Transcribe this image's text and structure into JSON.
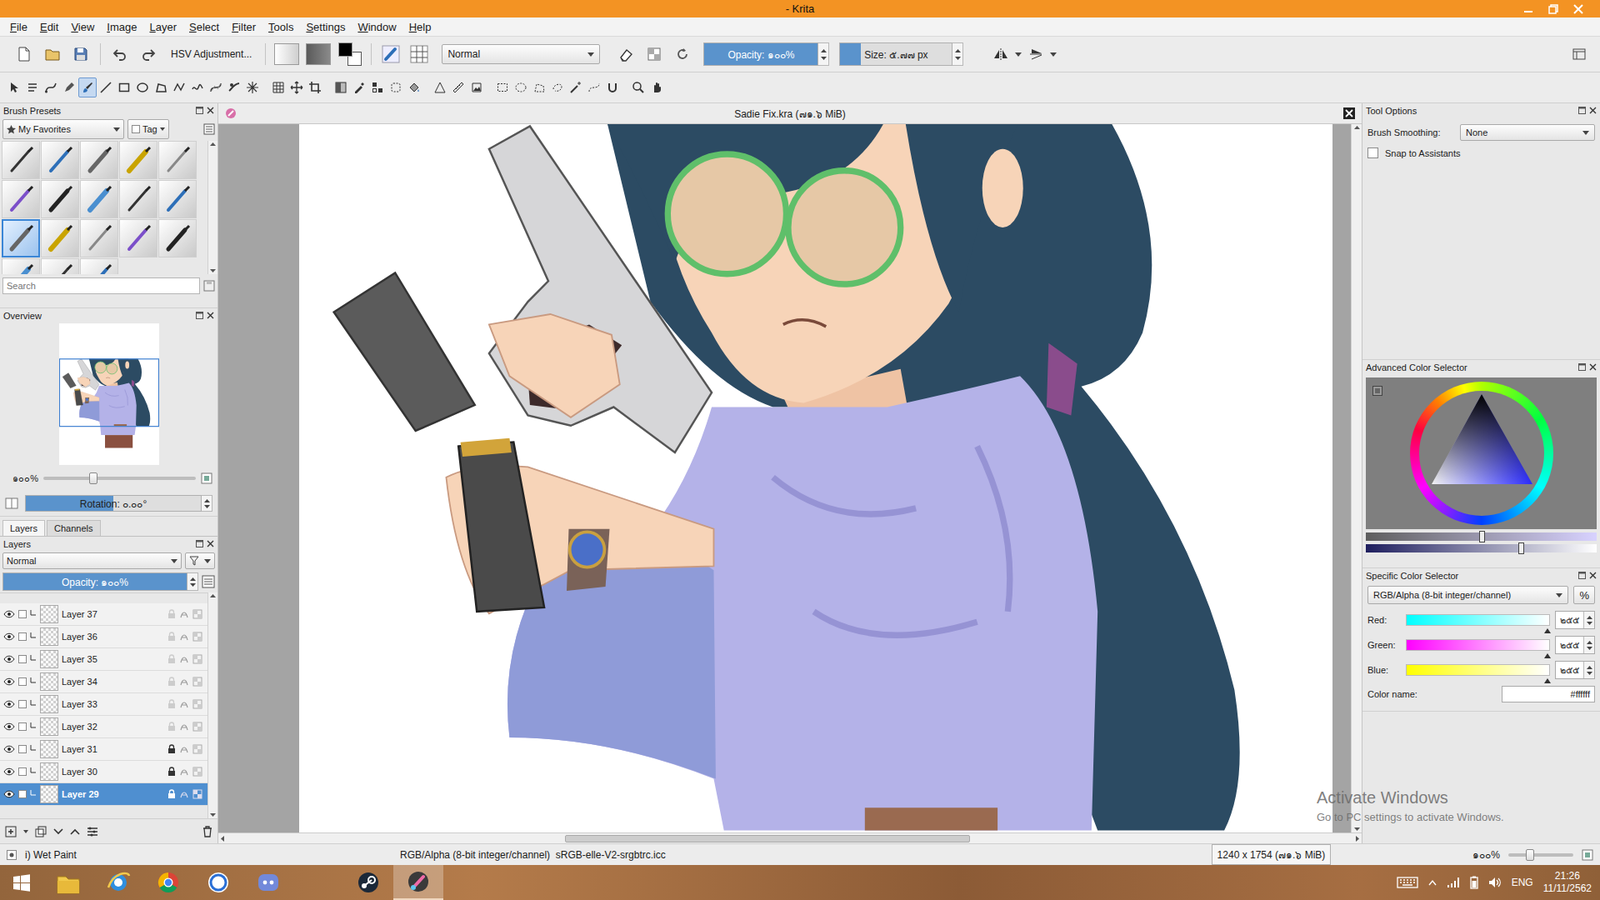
{
  "window": {
    "title": "- Krita"
  },
  "menu": [
    {
      "label": "File"
    },
    {
      "label": "Edit"
    },
    {
      "label": "View"
    },
    {
      "label": "Image"
    },
    {
      "label": "Layer"
    },
    {
      "label": "Select"
    },
    {
      "label": "Filter"
    },
    {
      "label": "Tools"
    },
    {
      "label": "Settings"
    },
    {
      "label": "Window"
    },
    {
      "label": "Help"
    }
  ],
  "toolbar": {
    "filter": "HSV Adjustment...",
    "foreground": "#000000",
    "background": "#ffffff",
    "blend_mode": "Normal",
    "opacity": {
      "reading": "Opacity: ๑๐๐%",
      "level": 1
    },
    "size": {
      "reading": "Size: ๕.๗๗ px",
      "level": 0.18
    }
  },
  "tools": {
    "groups": [
      [
        {
          "selected": false
        },
        {
          "selected": false
        },
        {
          "selected": false
        },
        {
          "selected": false
        },
        {
          "selected": true
        },
        {
          "selected": false
        },
        {
          "selected": false
        },
        {
          "selected": false
        },
        {
          "selected": false
        },
        {
          "selected": false
        },
        {
          "selected": false
        },
        {
          "selected": false
        },
        {
          "selected": false
        },
        {
          "selected": false
        }
      ],
      [
        {
          "selected": false
        },
        {
          "selected": false
        },
        {
          "selected": false
        }
      ],
      [
        {
          "selected": false
        },
        {
          "selected": false
        },
        {
          "selected": false
        },
        {
          "selected": false
        },
        {
          "selected": false
        }
      ],
      [
        {
          "selected": false
        },
        {
          "selected": false
        },
        {
          "selected": false
        }
      ],
      [
        {
          "selected": false
        },
        {
          "selected": false
        },
        {
          "selected": false
        },
        {
          "selected": false
        },
        {
          "selected": false
        },
        {
          "selected": false
        },
        {
          "selected": false
        }
      ],
      [
        {
          "selected": false
        },
        {
          "selected": false
        }
      ]
    ]
  },
  "brush_presets": {
    "title": "Brush Presets",
    "tag": "My Favorites",
    "tag_button": "Tag",
    "search_placeholder": "Search",
    "presets": [
      {
        "selected": false
      },
      {
        "selected": false
      },
      {
        "selected": false
      },
      {
        "selected": false
      },
      {
        "selected": false
      },
      {
        "selected": false
      },
      {
        "selected": false
      },
      {
        "selected": false
      },
      {
        "selected": false
      },
      {
        "selected": false
      },
      {
        "selected": true
      },
      {
        "selected": false
      },
      {
        "selected": false
      },
      {
        "selected": false
      },
      {
        "selected": false
      },
      {
        "selected": false
      },
      {
        "selected": false
      },
      {
        "selected": false
      }
    ]
  },
  "overview": {
    "title": "Overview",
    "zoom": "๑๐๐%",
    "zoom_level": 0.33,
    "rotation": "Rotation: ๐.๐๐°",
    "rotation_level": 0.5
  },
  "layers": {
    "tabs": [
      {
        "label": "Layers",
        "selected": true
      },
      {
        "label": "Channels",
        "selected": false
      }
    ],
    "title": "Layers",
    "blend_mode": "Normal",
    "opacity": {
      "reading": "Opacity: ๑๐๐%",
      "level": 1
    },
    "items": [
      {
        "name": "Layer 37",
        "visible": true,
        "locked": false,
        "selected": false
      },
      {
        "name": "Layer 36",
        "visible": true,
        "locked": false,
        "selected": false
      },
      {
        "name": "Layer 35",
        "visible": true,
        "locked": false,
        "selected": false
      },
      {
        "name": "Layer 34",
        "visible": true,
        "locked": false,
        "selected": false
      },
      {
        "name": "Layer 33",
        "visible": true,
        "locked": false,
        "selected": false
      },
      {
        "name": "Layer 32",
        "visible": true,
        "locked": false,
        "selected": false
      },
      {
        "name": "Layer 31",
        "visible": true,
        "locked": true,
        "selected": false
      },
      {
        "name": "Layer 30",
        "visible": true,
        "locked": true,
        "selected": false
      },
      {
        "name": "Layer 29",
        "visible": true,
        "locked": true,
        "selected": true
      }
    ]
  },
  "document": {
    "title": "Sadie Fix.kra (๗๑.๖ MiB)"
  },
  "tool_options": {
    "title": "Tool Options",
    "smoothing_label": "Brush Smoothing:",
    "smoothing_value": "None",
    "snap_label": "Snap to Assistants",
    "snap_checked": false
  },
  "advanced_color": {
    "title": "Advanced Color Selector",
    "sliders": [
      {
        "level": 0.5
      },
      {
        "level": 0.67
      }
    ]
  },
  "specific_color": {
    "title": "Specific Color Selector",
    "model": "RGB/Alpha (8-bit integer/channel)",
    "percent": "%",
    "channels": [
      {
        "label": "Red:",
        "value": "๒๕๕",
        "level": 1,
        "color": "#00ffff"
      },
      {
        "label": "Green:",
        "value": "๒๕๕",
        "level": 1,
        "color": "#ff00ff"
      },
      {
        "label": "Blue:",
        "value": "๒๕๕",
        "level": 1,
        "color": "#ffff00"
      }
    ],
    "color_name_label": "Color name:",
    "color_name": "#ffffff"
  },
  "status_bar": {
    "tool": "i) Wet Paint",
    "color_space": "RGB/Alpha (8-bit integer/channel)  sRGB-elle-V2-srgbtrc.icc",
    "image_size": "1240 x 1754 (๗๑.๖ MiB)",
    "zoom": "๑๐๐%",
    "zoom_level": 0.33
  },
  "watermark": {
    "title": "Activate Windows",
    "subtitle": "Go to PC settings to activate Windows."
  },
  "taskbar": {
    "apps": [
      {
        "kind": "explorer",
        "selected": false
      },
      {
        "kind": "ie",
        "selected": false
      },
      {
        "kind": "chrome",
        "selected": false
      },
      {
        "kind": "wps",
        "selected": false
      },
      {
        "kind": "discord",
        "selected": false
      },
      {
        "kind": "steam",
        "selected": false
      },
      {
        "kind": "krita",
        "selected": true
      }
    ],
    "lang": "ENG",
    "time": "21:26",
    "date": "11/11/2562"
  }
}
